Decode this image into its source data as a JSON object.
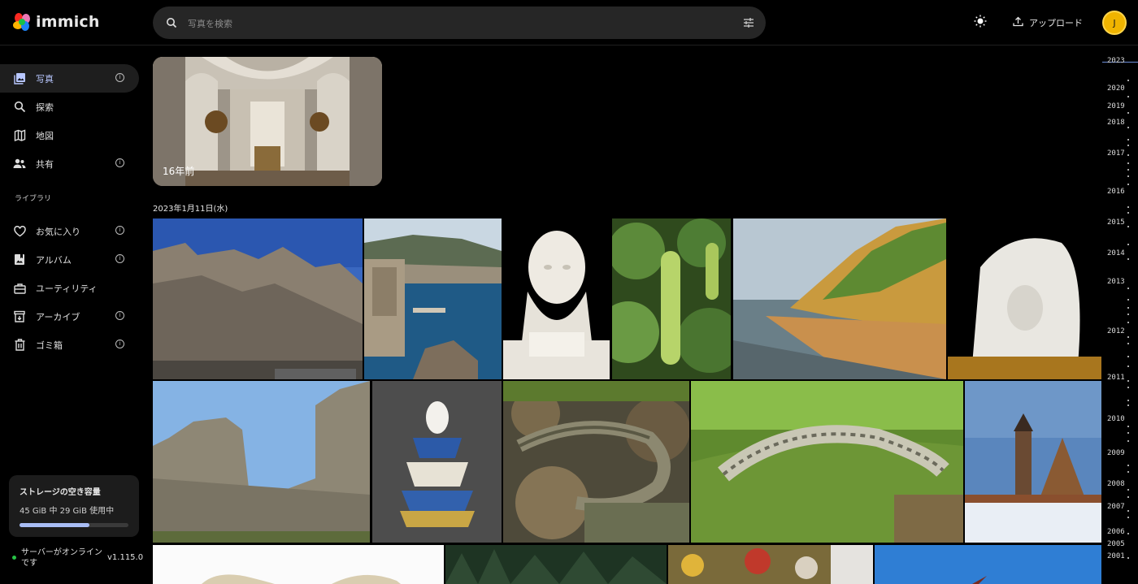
{
  "app": {
    "name": "immich"
  },
  "header": {
    "search_placeholder": "写真を検索",
    "upload_label": "アップロード",
    "avatar_initial": "J",
    "icons": [
      "search-icon",
      "tune-icon",
      "sun-icon",
      "upload-icon"
    ]
  },
  "sidebar": {
    "items": [
      {
        "label": "写真",
        "icon": "photos-icon",
        "info": true,
        "active": true
      },
      {
        "label": "探索",
        "icon": "magnify-icon",
        "info": false
      },
      {
        "label": "地図",
        "icon": "map-icon",
        "info": false
      },
      {
        "label": "共有",
        "icon": "share-people-icon",
        "info": true
      },
      {
        "label": "お気に入り",
        "icon": "heart-icon",
        "info": true
      },
      {
        "label": "アルバム",
        "icon": "album-icon",
        "info": true
      },
      {
        "label": "ユーティリティ",
        "icon": "toolbox-icon",
        "info": false
      },
      {
        "label": "アーカイブ",
        "icon": "archive-icon",
        "info": true
      },
      {
        "label": "ゴミ箱",
        "icon": "trash-icon",
        "info": true
      }
    ],
    "library_label": "ライブラリ",
    "storage": {
      "title": "ストレージの空き容量",
      "usage": "45 GiB 中 29 GiB 使用中",
      "used_fraction": 0.64
    },
    "server": {
      "status": "サーバーがオンラインです",
      "version": "v1.115.0"
    },
    "info_glyph": "i"
  },
  "main": {
    "memory": {
      "label": "16年前"
    },
    "date_group": "2023年1月11日(水)",
    "photos": [
      "dubrovnik-walls",
      "dubrovnik-harbor",
      "marble-bust",
      "sea-grape",
      "beach-cliff",
      "marble-sculpture",
      "ruined-fortress",
      "porcelain-centerpiece",
      "lizard-leaves",
      "lizard-moss",
      "wooden-church",
      "white-object",
      "forest",
      "flowers",
      "sky"
    ]
  },
  "scrubber": {
    "years": [
      "2023",
      "2020",
      "2019",
      "2018",
      "2017",
      "2016",
      "2015",
      "2014",
      "2013",
      "2012",
      "2011",
      "2010",
      "2009",
      "2008",
      "2007",
      "2006",
      "2005",
      "2001"
    ]
  }
}
